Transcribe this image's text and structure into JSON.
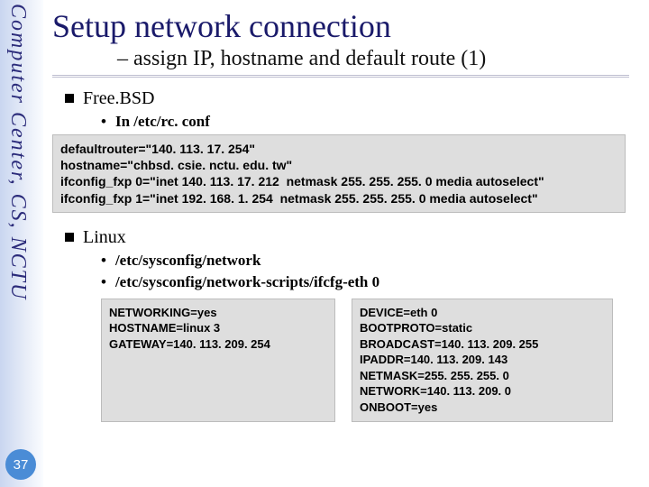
{
  "sidebar": {
    "label": "Computer Center, CS, NCTU"
  },
  "pageNumber": "37",
  "title": "Setup network connection",
  "subtitle": "– assign IP, hostname and default route (1)",
  "sections": {
    "freebsd": {
      "head": "Free.BSD",
      "sub": "In /etc/rc. conf",
      "code": "defaultrouter=\"140. 113. 17. 254\"\nhostname=\"chbsd. csie. nctu. edu. tw\"\nifconfig_fxp 0=\"inet 140. 113. 17. 212  netmask 255. 255. 255. 0 media autoselect\"\nifconfig_fxp 1=\"inet 192. 168. 1. 254  netmask 255. 255. 255. 0 media autoselect\""
    },
    "linux": {
      "head": "Linux",
      "sub1": "/etc/sysconfig/network",
      "sub2": "/etc/sysconfig/network-scripts/ifcfg-eth 0",
      "codeA": "NETWORKING=yes\nHOSTNAME=linux 3\nGATEWAY=140. 113. 209. 254",
      "codeB": "DEVICE=eth 0\nBOOTPROTO=static\nBROADCAST=140. 113. 209. 255\nIPADDR=140. 113. 209. 143\nNETMASK=255. 255. 255. 0\nNETWORK=140. 113. 209. 0\nONBOOT=yes"
    }
  }
}
